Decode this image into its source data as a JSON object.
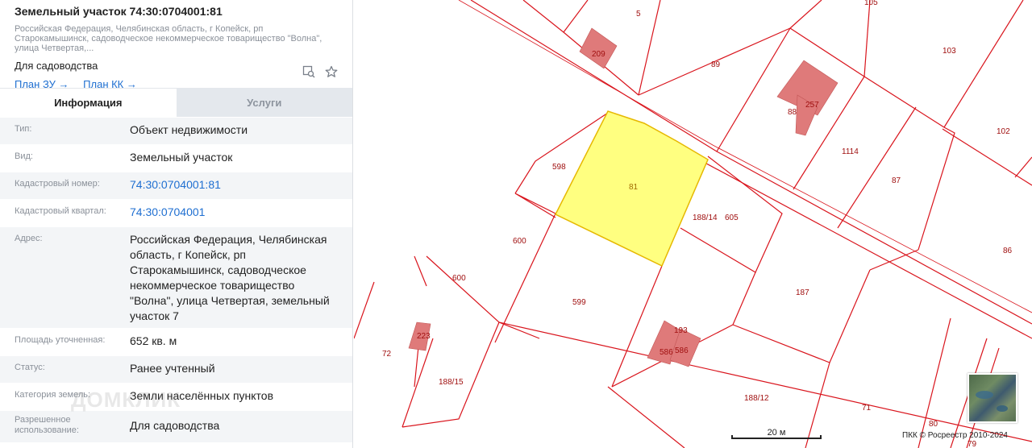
{
  "header": {
    "title": "Земельный участок 74:30:0704001:81",
    "address_short": "Российская Федерация, Челябинская область, г Копейск, рп Старокамышинск, садоводческое некоммерческое товарищество \"Волна\", улица Четвертая,...",
    "purpose": "Для садоводства",
    "link_zu": "План ЗУ →",
    "link_kk": "План КК →"
  },
  "tabs": [
    {
      "label": "Информация",
      "active": true
    },
    {
      "label": "Услуги",
      "active": false
    }
  ],
  "rows": [
    {
      "key": "Тип:",
      "value": "Объект недвижимости"
    },
    {
      "key": "Вид:",
      "value": "Земельный участок"
    },
    {
      "key": "Кадастровый номер:",
      "value": "74:30:0704001:81"
    },
    {
      "key": "Кадастровый квартал:",
      "value": "74:30:0704001"
    },
    {
      "key": "Адрес:",
      "value": "Российская Федерация, Челябинская область, г Копейск, рп Старокамышинск, садоводческое некоммерческое товарищество \"Волна\", улица Четвертая, земельный участок 7"
    },
    {
      "key": "Площадь уточненная:",
      "value": "652 кв. м"
    },
    {
      "key": "Статус:",
      "value": "Ранее учтенный"
    },
    {
      "key": "Категория земель:",
      "value": "Земли населённых пунктов"
    },
    {
      "key": "Разрешенное использование:",
      "value": "Для садоводства"
    }
  ],
  "watermark": "ДОМКЛИК",
  "map": {
    "parcel_labels": [
      "5",
      "105",
      "103",
      "89",
      "88",
      "257",
      "209",
      "1114",
      "102",
      "87",
      "598",
      "81",
      "188/14",
      "605",
      "600",
      "600",
      "599",
      "187",
      "86",
      "193",
      "586",
      "586",
      "223",
      "72",
      "188/15",
      "188/12",
      "71",
      "80",
      "79"
    ],
    "scale_label": "20 м",
    "copyright": "ПКК © Росреестр 2010-2024",
    "colors": {
      "highlight_fill": "#ffff80",
      "highlight_stroke": "#e6b800",
      "parcel_stroke": "#d9141c",
      "building_fill": "#df7a7a",
      "link": "#1f6fd1"
    }
  }
}
